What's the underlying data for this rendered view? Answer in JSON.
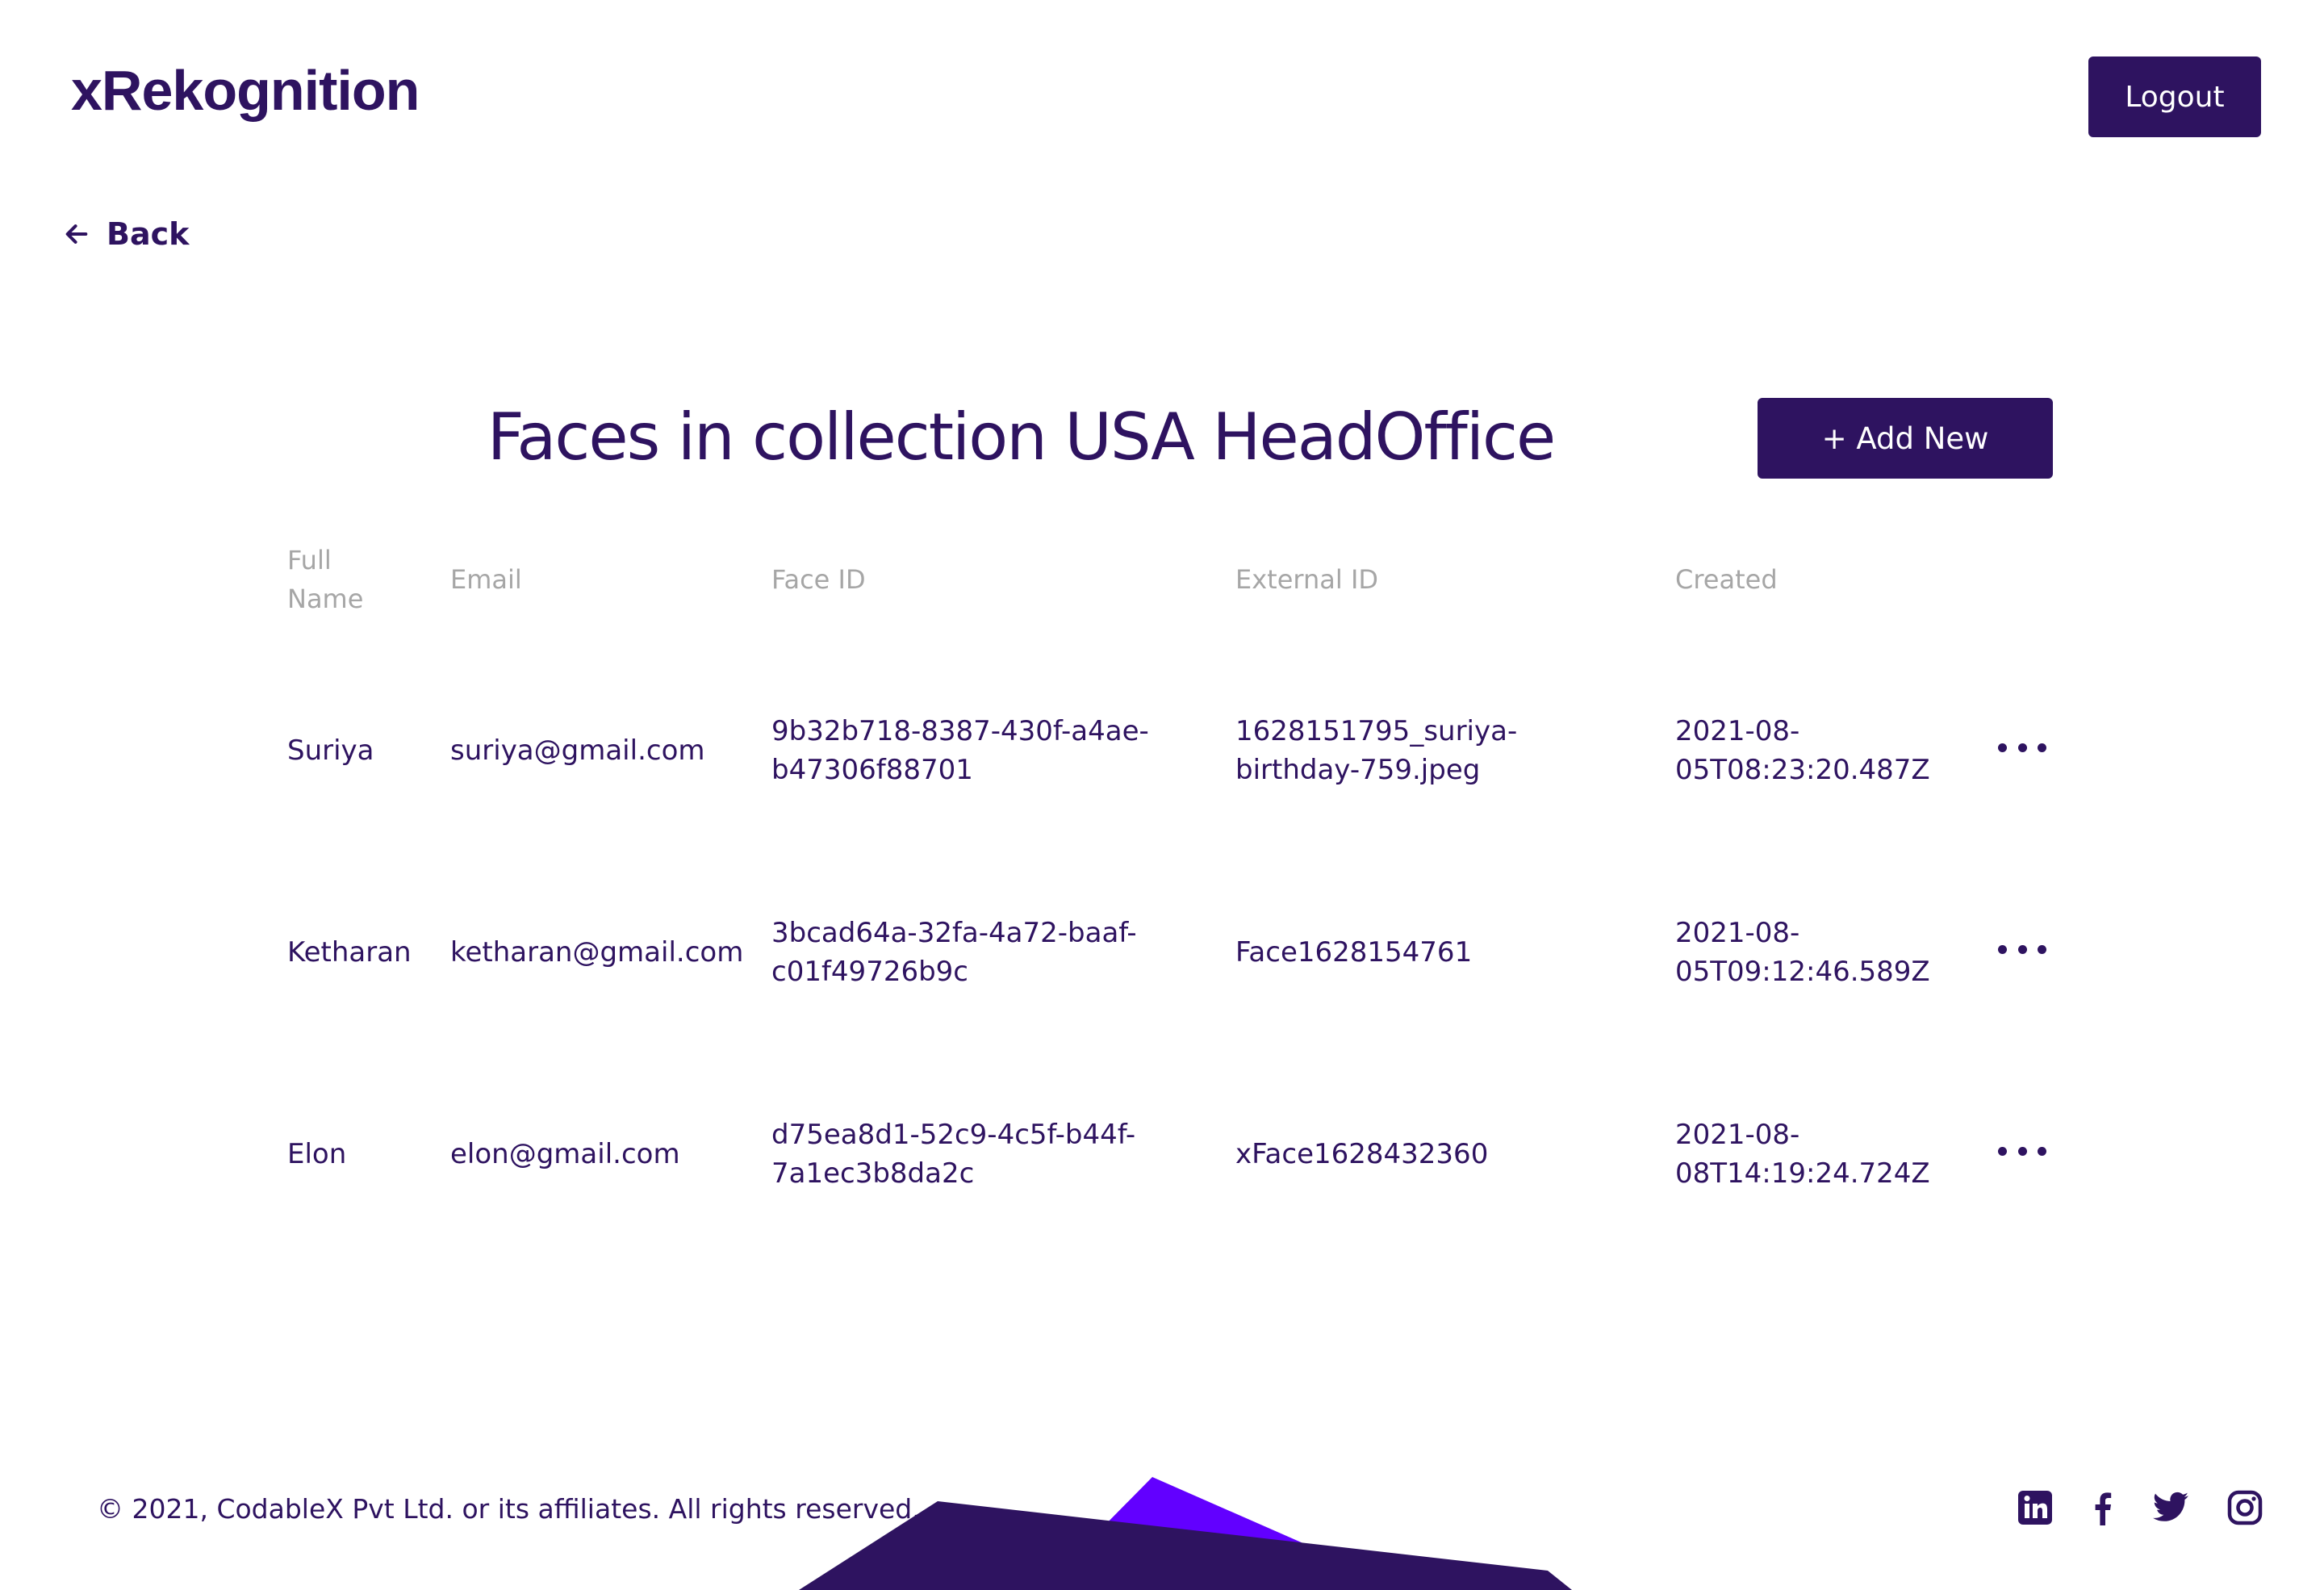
{
  "header": {
    "logo": "xRekognition",
    "logout_label": "Logout"
  },
  "nav": {
    "back_label": "Back"
  },
  "main": {
    "title": "Faces in collection USA HeadOffice",
    "add_new_label": "+ Add New"
  },
  "table": {
    "columns": {
      "full_name": "Full Name",
      "email": "Email",
      "face_id": "Face ID",
      "external_id": "External ID",
      "created": "Created"
    },
    "rows": [
      {
        "full_name": "Suriya",
        "email": "suriya@gmail.com",
        "face_id": "9b32b718-8387-430f-a4ae-b47306f88701",
        "external_id": "1628151795_suriya-birthday-759.jpeg",
        "created": "2021-08-05T08:23:20.487Z"
      },
      {
        "full_name": "Ketharan",
        "email": "ketharan@gmail.com",
        "face_id": "3bcad64a-32fa-4a72-baaf-c01f49726b9c",
        "external_id": "Face1628154761",
        "created": "2021-08-05T09:12:46.589Z"
      },
      {
        "full_name": "Elon",
        "email": "elon@gmail.com",
        "face_id": "d75ea8d1-52c9-4c5f-b44f-7a1ec3b8da2c",
        "external_id": "xFace1628432360",
        "created": "2021-08-08T14:19:24.724Z"
      }
    ]
  },
  "footer": {
    "copyright": "© 2021, CodableX Pvt Ltd. or its affiliates. All rights reserved.",
    "social_icons": [
      "linkedin-icon",
      "facebook-icon",
      "twitter-icon",
      "instagram-icon"
    ]
  },
  "colors": {
    "primary": "#2e1360",
    "accent": "#6200ff",
    "header_text": "#a6a6a6",
    "background": "#ffffff"
  }
}
